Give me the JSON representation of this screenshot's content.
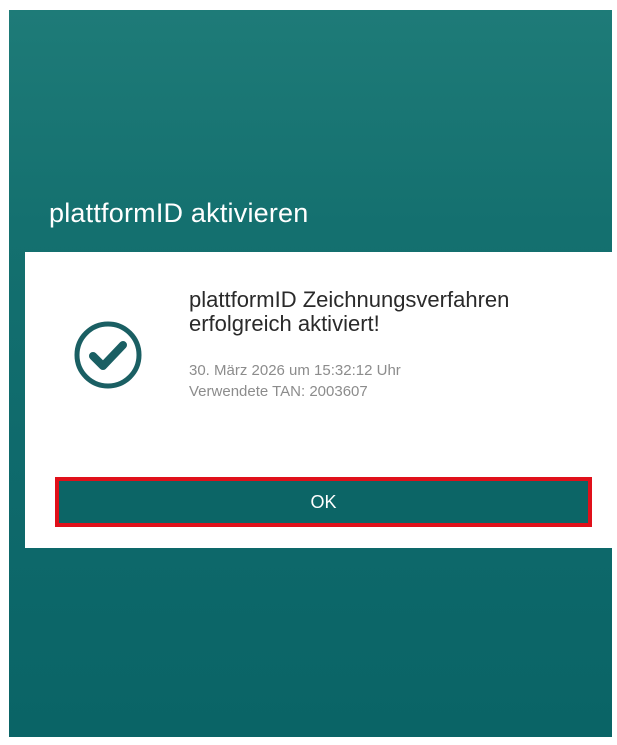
{
  "dialog": {
    "title": "plattformID aktivieren",
    "message": "plattformID Zeichnungsverfahren erfolgreich aktiviert!",
    "timestamp": "30. März 2026 um 15:32:12 Uhr",
    "tan_info": "Verwendete TAN: 2003607",
    "ok_label": "OK",
    "icon": "check-circle-icon"
  },
  "colors": {
    "background": "#0f6a6c",
    "button": "#0c6566",
    "highlight": "#e0101a",
    "icon": "#1a5f63"
  }
}
